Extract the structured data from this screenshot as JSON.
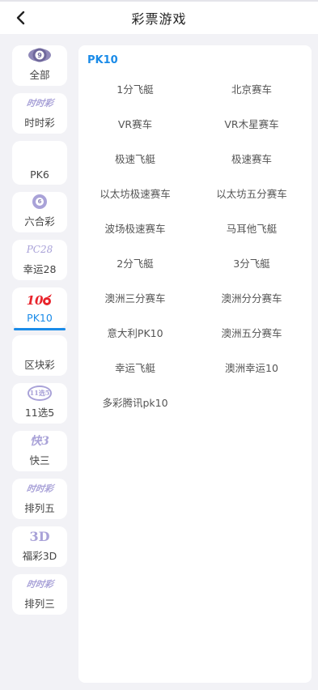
{
  "header": {
    "title": "彩票游戏"
  },
  "sidebar": {
    "items": [
      {
        "label": "全部",
        "icon": "ball-9-icon",
        "badge": "9"
      },
      {
        "label": "时时彩",
        "icon": "ssc-logo-icon",
        "badge": "时时彩"
      },
      {
        "label": "PK6",
        "icon": ""
      },
      {
        "label": "六合彩",
        "icon": "ball-6-icon",
        "badge": "6"
      },
      {
        "label": "幸运28",
        "icon": "pc28-logo-icon",
        "badge": "PC28"
      },
      {
        "label": "PK10",
        "icon": "pk10-logo-icon",
        "badge": "10"
      },
      {
        "label": "区块彩",
        "icon": ""
      },
      {
        "label": "11选5",
        "icon": "11x5-logo-icon",
        "badge": "11选5"
      },
      {
        "label": "快三",
        "icon": "k3-logo-icon",
        "badge": "快3"
      },
      {
        "label": "排列五",
        "icon": "pl5-logo-icon",
        "badge": "时时彩"
      },
      {
        "label": "福彩3D",
        "icon": "fc3d-logo-icon",
        "badge": "3D"
      },
      {
        "label": "排列三",
        "icon": "pl3-logo-icon",
        "badge": "时时彩"
      }
    ],
    "active_index": 5
  },
  "panel": {
    "title": "PK10",
    "games": [
      "1分飞艇",
      "北京赛车",
      "VR赛车",
      "VR木星赛车",
      "极速飞艇",
      "极速赛车",
      "以太坊极速赛车",
      "以太坊五分赛车",
      "波场极速赛车",
      "马耳他飞艇",
      "2分飞艇",
      "3分飞艇",
      "澳洲三分赛车",
      "澳洲分分赛车",
      "意大利PK10",
      "澳洲五分赛车",
      "幸运飞艇",
      "澳洲幸运10",
      "多彩腾讯pk10"
    ]
  },
  "colors": {
    "accent": "#1a8be8",
    "icon_purple": "#a9a2d8"
  }
}
